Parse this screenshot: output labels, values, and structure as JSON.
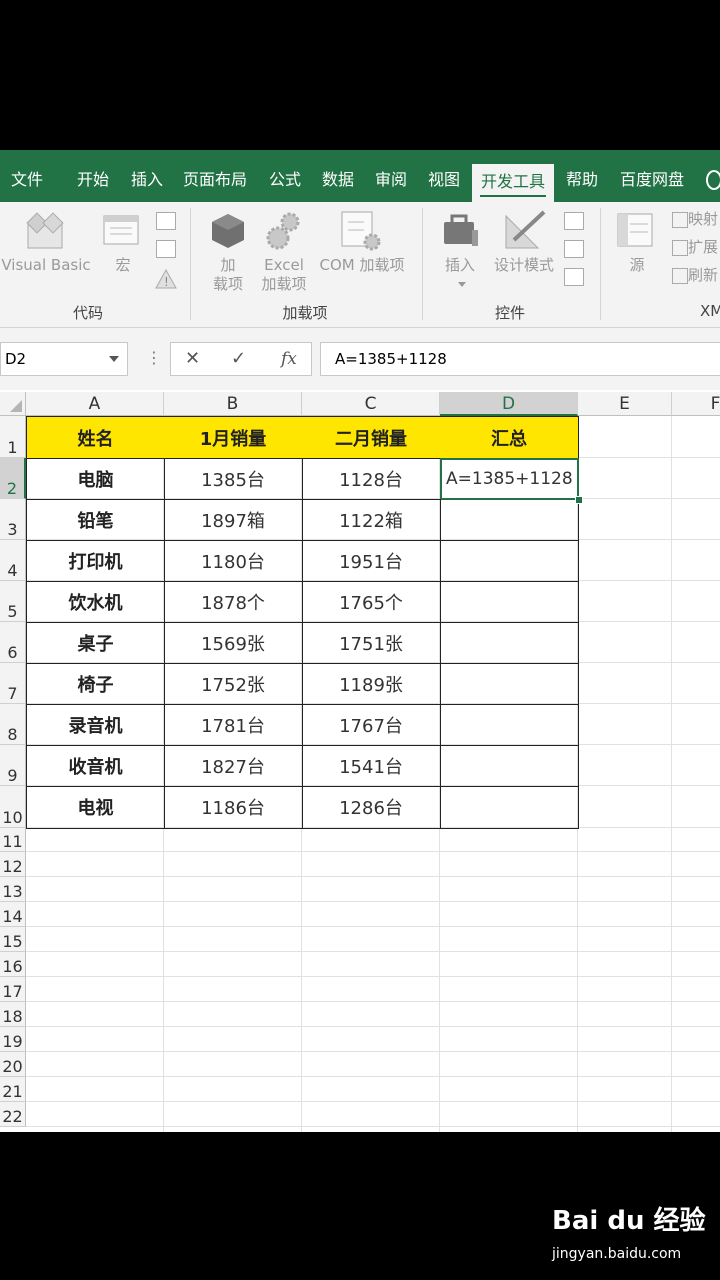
{
  "menu": {
    "tabs": [
      "文件",
      "开始",
      "插入",
      "页面布局",
      "公式",
      "数据",
      "审阅",
      "视图",
      "开发工具",
      "帮助",
      "百度网盘"
    ],
    "active": "开发工具"
  },
  "ribbon": {
    "code": {
      "label": "代码",
      "visual_basic": "Visual Basic",
      "macro": "宏"
    },
    "addins": {
      "label": "加载项",
      "addin_line1": "加",
      "addin_line2": "载项",
      "excel_line1": "Excel",
      "excel_line2": "加载项",
      "com": "COM 加载项"
    },
    "controls": {
      "label": "控件",
      "insert": "插入",
      "design_mode": "设计模式"
    },
    "xml": {
      "label": "XM",
      "source": "源",
      "mapping": "映射",
      "expand": "扩展",
      "refresh": "刷新"
    }
  },
  "formula_bar": {
    "name_box": "D2",
    "formula": "A=1385+1128"
  },
  "sheet": {
    "columns": [
      "A",
      "B",
      "C",
      "D",
      "E",
      "F"
    ],
    "selected_column": "D",
    "rows": [
      "1",
      "2",
      "3",
      "4",
      "5",
      "6",
      "7",
      "8",
      "9",
      "10",
      "11",
      "12",
      "13",
      "14",
      "15",
      "16",
      "17",
      "18",
      "19",
      "20",
      "21",
      "22"
    ],
    "selected_row": "2",
    "headers": [
      "姓名",
      "1月销量",
      "二月销量",
      "汇总"
    ],
    "data": [
      [
        "电脑",
        "1385台",
        "1128台",
        "A=1385+1128"
      ],
      [
        "铅笔",
        "1897箱",
        "1122箱",
        ""
      ],
      [
        "打印机",
        "1180台",
        "1951台",
        ""
      ],
      [
        "饮水机",
        "1878个",
        "1765个",
        ""
      ],
      [
        "桌子",
        "1569张",
        "1751张",
        ""
      ],
      [
        "椅子",
        "1752张",
        "1189张",
        ""
      ],
      [
        "录音机",
        "1781台",
        "1767台",
        ""
      ],
      [
        "收音机",
        "1827台",
        "1541台",
        ""
      ],
      [
        "电视",
        "1186台",
        "1286台",
        ""
      ]
    ]
  },
  "watermark": {
    "brand": "Bai du 经验",
    "url": "jingyan.baidu.com"
  },
  "colors": {
    "accent": "#217346",
    "header_fill": "#ffe600"
  }
}
